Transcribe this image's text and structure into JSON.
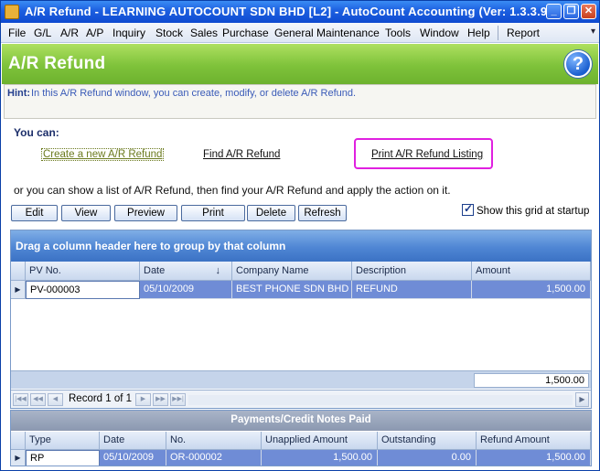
{
  "window": {
    "title": "A/R Refund - LEARNING AUTOCOUNT SDN BHD [L2] - AutoCount Accounting (Ver: 1.3.3.9)",
    "minimize": "_",
    "restore": "❐",
    "close": "✕"
  },
  "menu": {
    "items": [
      "File",
      "G/L",
      "A/R",
      "A/P",
      "Inquiry",
      "Stock",
      "Sales",
      "Purchase",
      "General Maintenance",
      "Tools",
      "Window",
      "Help",
      "Report"
    ],
    "chevron": "▾"
  },
  "header": {
    "title": "A/R Refund",
    "help": "?"
  },
  "hint": {
    "label": "Hint:",
    "text": "In this A/R Refund window, you can create, modify, or delete A/R Refund."
  },
  "actions": {
    "heading": "You can:",
    "create": "Create a new A/R Refund",
    "find": "Find A/R Refund",
    "print": "Print A/R Refund Listing",
    "list_hint": "or you can show a list of A/R Refund, then find your A/R Refund and apply the action on it."
  },
  "toolbar": {
    "buttons": [
      "Edit",
      "View",
      "Preview",
      "Print",
      "Delete",
      "Refresh"
    ],
    "show_grid_label": "Show this grid at startup",
    "show_grid_checked": true
  },
  "grid": {
    "group_hint": "Drag a column header here to group by that column",
    "columns": [
      "PV No.",
      "Date",
      "Company Name",
      "Description",
      "Amount"
    ],
    "sort_indicator": "↓",
    "rows": [
      {
        "pv_no": "PV-000003",
        "date": "05/10/2009",
        "company": "BEST PHONE SDN BHD",
        "description": "REFUND",
        "amount": "1,500.00"
      }
    ],
    "total": "1,500.00",
    "record_text": "Record 1 of 1"
  },
  "payments": {
    "title": "Payments/Credit Notes Paid",
    "columns": [
      "Type",
      "Date",
      "No.",
      "Unapplied Amount",
      "Outstanding",
      "Refund Amount"
    ],
    "rows": [
      {
        "type": "RP",
        "date": "05/10/2009",
        "no": "OR-000002",
        "unapplied": "1,500.00",
        "outstanding": "0.00",
        "refund": "1,500.00"
      }
    ]
  },
  "colors": {
    "title_bar": "#1c5fe0",
    "header_green": "#7ec23a",
    "highlight": "#e020e0",
    "selected_row": "#6f8cd6"
  }
}
